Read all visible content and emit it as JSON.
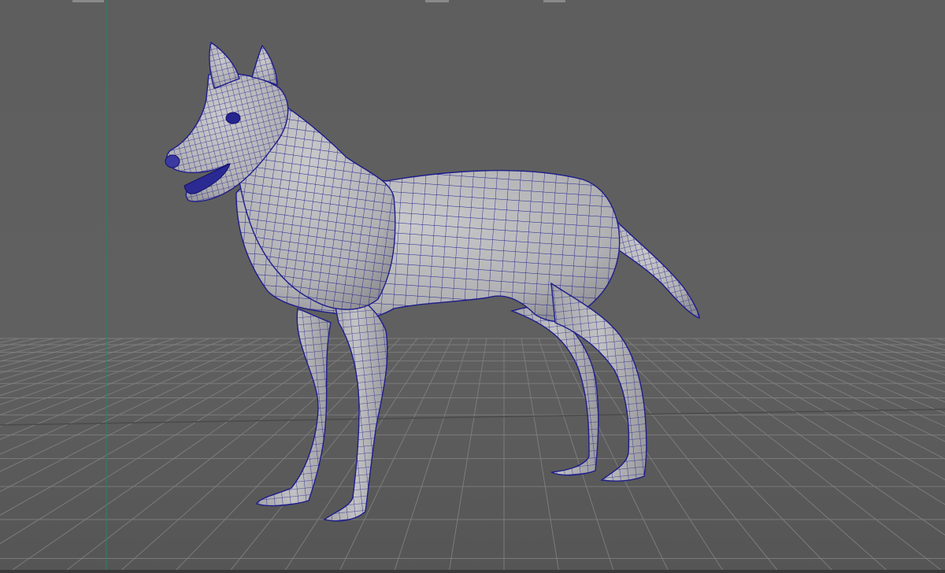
{
  "viewport": {
    "name": "perspective-viewport",
    "background_color": "#5e5e5e",
    "grid_color": "#808080",
    "grid_dark_color": "#4a4a4a",
    "axis_line_color": "#2f7d66",
    "wireframe_color": "#1e1c8a",
    "mesh_fill_color": "#b4b4b6",
    "mesh_shadow_color": "#8e8e92"
  },
  "scene": {
    "object": "dog-model",
    "display_mode": "wireframe-on-shaded",
    "selected": true
  }
}
